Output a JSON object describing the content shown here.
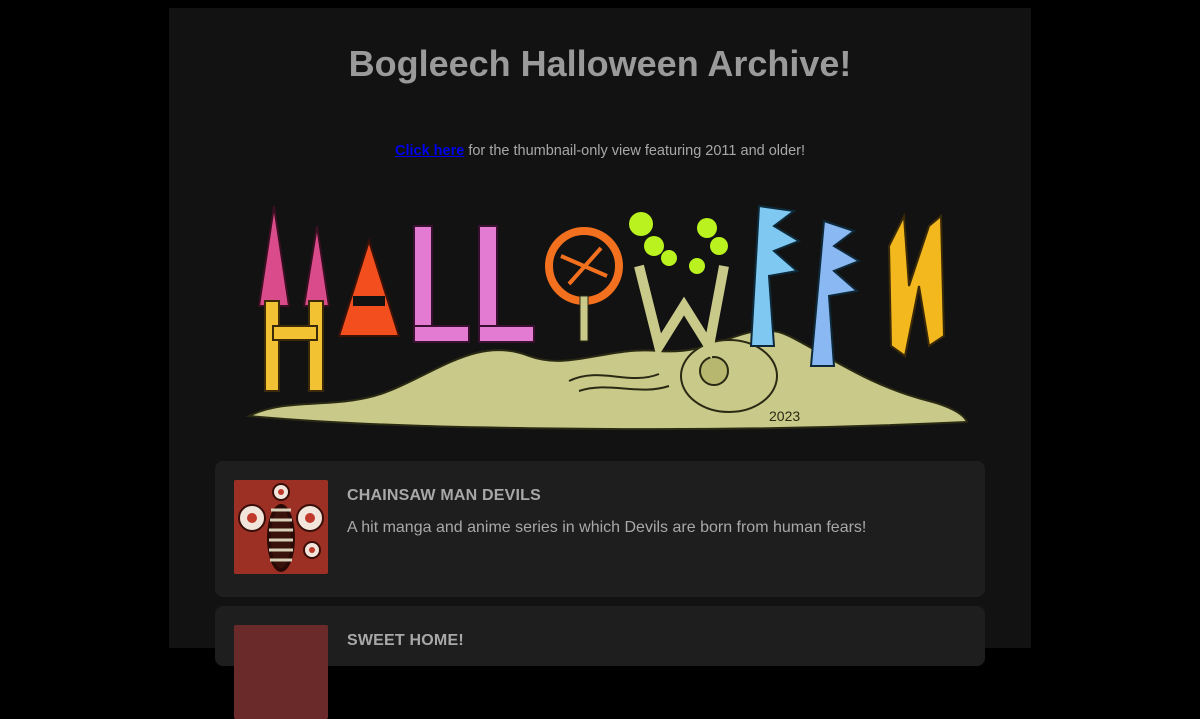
{
  "page": {
    "title": "Bogleech Halloween Archive!",
    "intro": {
      "link_text": "Click here",
      "rest_text": " for the thumbnail-only view featuring 2011 and older!"
    },
    "banner": {
      "letters": [
        "H",
        "A",
        "L",
        "L",
        "O",
        "W",
        "E",
        "E",
        "N"
      ],
      "year": "2023"
    },
    "articles": [
      {
        "title": "CHAINSAW MAN DEVILS",
        "description": "A hit manga and anime series in which Devils are born from human fears!"
      },
      {
        "title": "SWEET HOME!",
        "description": ""
      }
    ]
  },
  "colors": {
    "background": "#000000",
    "content_bg": "#121212",
    "card_bg": "#1e1e1e",
    "text": "#a8a8a8",
    "link": "#0000ee",
    "banner_palette": [
      "#d94b8a",
      "#f2c232",
      "#f24e1e",
      "#e27bd1",
      "#f2701e",
      "#b9f21e",
      "#7ec8f2",
      "#8ab8f2",
      "#f2b81e",
      "#c9c98a"
    ]
  }
}
